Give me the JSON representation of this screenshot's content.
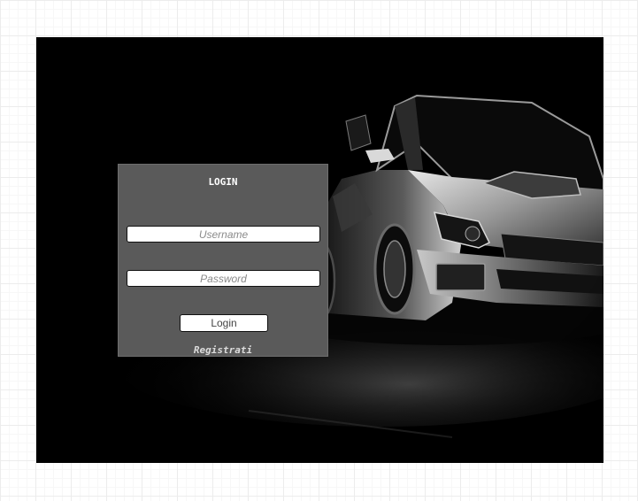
{
  "login": {
    "title": "LOGIN",
    "username_placeholder": "Username",
    "password_placeholder": "Password",
    "submit_label": "Login",
    "register_link": "Registrati"
  },
  "colors": {
    "page_background": "#ffffff",
    "stage_background": "#000000",
    "panel_background": "#5a5a5a",
    "title_text": "#ffffff",
    "link_text": "#dcdcdc"
  },
  "background_image": {
    "subject": "car-photo"
  }
}
